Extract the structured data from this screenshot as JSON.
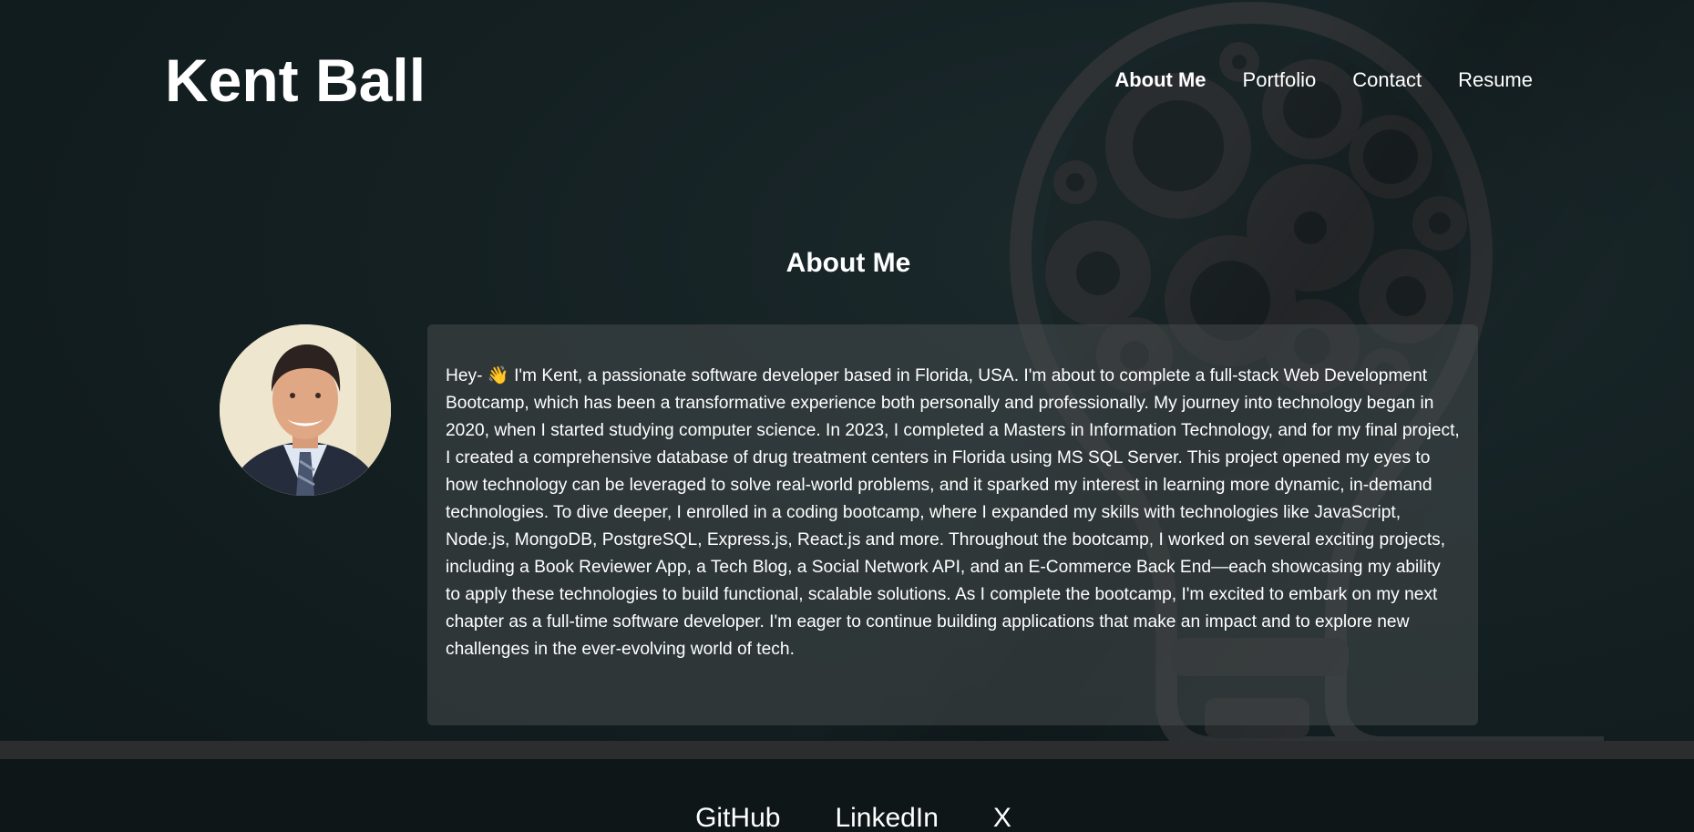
{
  "header": {
    "title": "Kent Ball",
    "nav": [
      {
        "label": "About Me",
        "active": true
      },
      {
        "label": "Portfolio",
        "active": false
      },
      {
        "label": "Contact",
        "active": false
      },
      {
        "label": "Resume",
        "active": false
      }
    ]
  },
  "about": {
    "heading": "About Me",
    "avatar_alt": "Kent Ball profile photo",
    "bio": "Hey- 👋 I'm Kent, a passionate software developer based in Florida, USA. I'm about to complete a full-stack Web Development Bootcamp, which has been a transformative experience both personally and professionally. My journey into technology began in 2020, when I started studying computer science. In 2023, I completed a Masters in Information Technology, and for my final project, I created a comprehensive database of drug treatment centers in Florida using MS SQL Server. This project opened my eyes to how technology can be leveraged to solve real-world problems, and it sparked my interest in learning more dynamic, in-demand technologies. To dive deeper, I enrolled in a coding bootcamp, where I expanded my skills with technologies like JavaScript, Node.js, MongoDB, PostgreSQL, Express.js, React.js and more. Throughout the bootcamp, I worked on several exciting projects, including a Book Reviewer App, a Tech Blog, a Social Network API, and an E-Commerce Back End—each showcasing my ability to apply these technologies to build functional, scalable solutions. As I complete the bootcamp, I'm excited to embark on my next chapter as a full-time software developer. I'm eager to continue building applications that make an impact and to explore new challenges in the ever-evolving world of tech."
  },
  "footer": {
    "links": [
      "GitHub",
      "LinkedIn",
      "X"
    ]
  },
  "colors": {
    "background": "#0f1a1c",
    "text": "#ffffff",
    "card": "#464a4c"
  },
  "icons": {
    "background_art": "lightbulb-with-gears-icon"
  }
}
